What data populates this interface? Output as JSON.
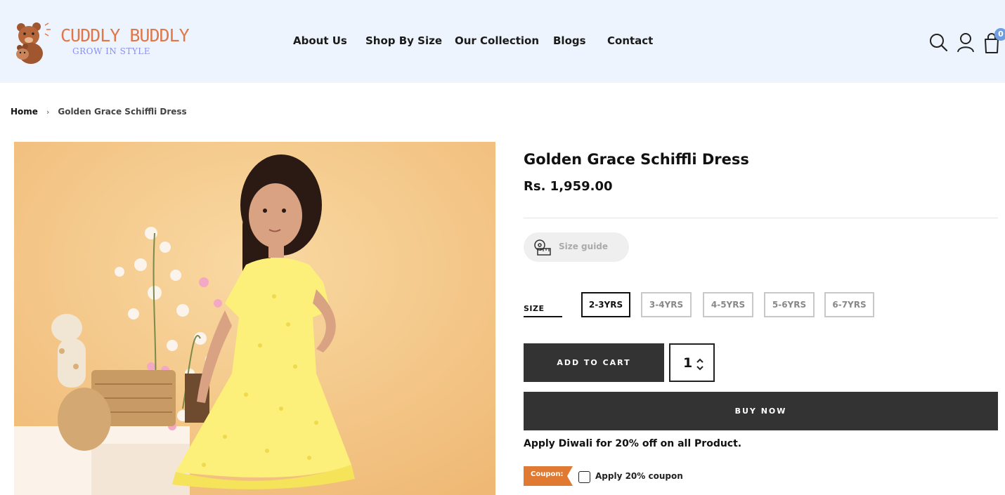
{
  "brand": {
    "name": "CUDDLY BUDDLY",
    "tagline": "GROW IN STYLE"
  },
  "nav": {
    "items": [
      "About Us",
      "Shop By Size",
      "Our Collection",
      "Blogs",
      "Contact"
    ]
  },
  "header_icons": {
    "search": "search-icon",
    "account": "user-icon",
    "cart": "cart-icon",
    "cart_count": "0"
  },
  "breadcrumb": {
    "home": "Home",
    "separator": "›",
    "current": "Golden Grace Schiffli Dress"
  },
  "product": {
    "title": "Golden Grace Schiffli Dress",
    "price": "Rs. 1,959.00",
    "size_guide_label": "Size guide",
    "size_label": "SIZE",
    "sizes": [
      "2-3YRS",
      "3-4YRS",
      "4-5YRS",
      "5-6YRS",
      "6-7YRS"
    ],
    "selected_size": "2-3YRS",
    "add_to_cart_label": "ADD TO CART",
    "quantity": "1",
    "buy_now_label": "BUY NOW",
    "promo_text": "Apply Diwali for 20% off on all Product.",
    "coupon_tag": "Coupon:",
    "coupon_checkbox_label": "Apply 20% coupon"
  },
  "colors": {
    "header_bg": "#eef4fd",
    "button_dark": "#333333",
    "brand_orange": "#e0774a",
    "coupon_orange": "#e07a33",
    "badge_blue": "#6f9ee0"
  }
}
